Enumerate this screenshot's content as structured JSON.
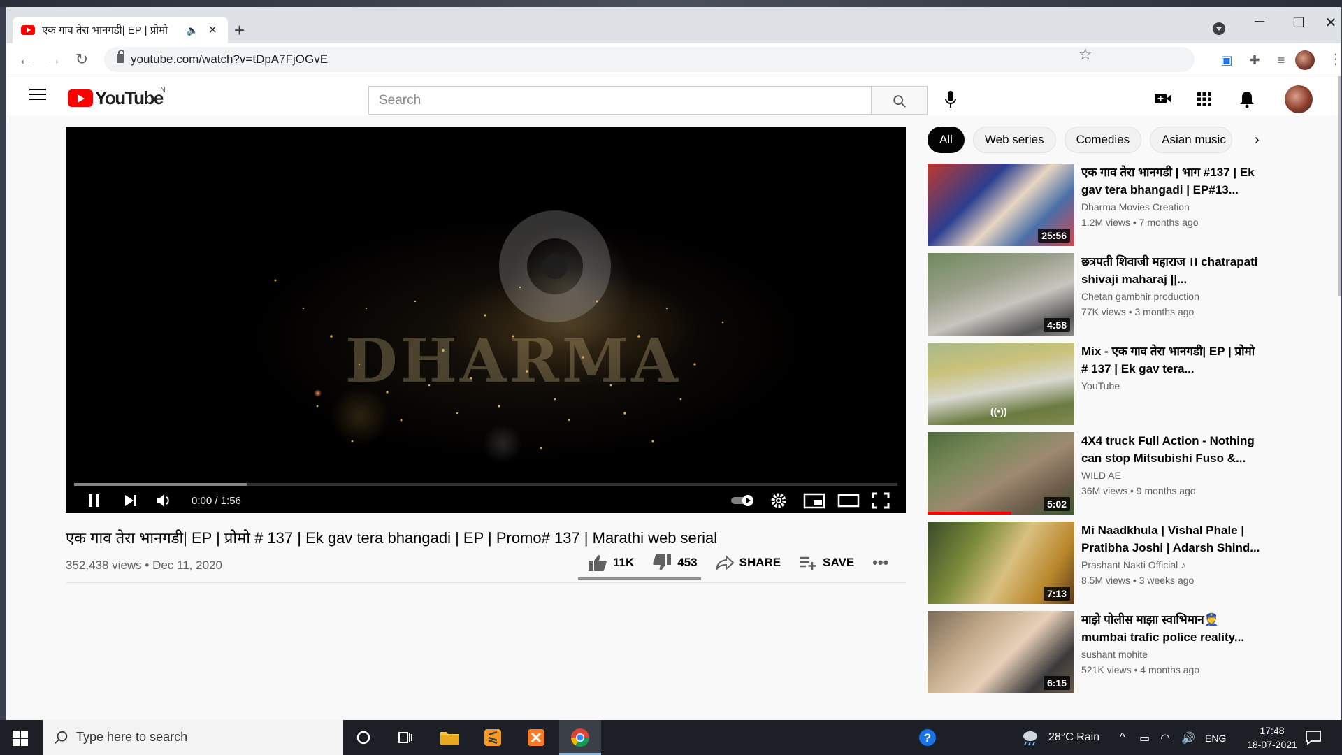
{
  "browser": {
    "tab_title": "एक गाव तेरा भानगडी| EP | प्रोमो",
    "url": "youtube.com/watch?v=tDpA7FjOGvE",
    "window_controls": {
      "minimize": "─",
      "maximize": "☐",
      "close": "✕"
    }
  },
  "youtube": {
    "logo_text": "YouTube",
    "country": "IN",
    "search_placeholder": "Search"
  },
  "player": {
    "time_display": "0:00 / 1:56",
    "wordmark": "DHARMA",
    "played_fraction": 0.0,
    "buffered_fraction": 0.21
  },
  "video": {
    "title": "एक गाव तेरा भानगडी| EP | प्रोमो # 137 | Ek gav tera bhangadi | EP | Promo# 137 | Marathi web serial",
    "views_date": "352,438 views • Dec 11, 2020",
    "likes": "11K",
    "dislikes": "453",
    "share_label": "SHARE",
    "save_label": "SAVE"
  },
  "chips": [
    "All",
    "Web series",
    "Comedies",
    "Asian music"
  ],
  "suggestions": [
    {
      "title": "एक गाव तेरा भानगडी | भाग #137 | Ek gav tera bhangadi | EP#13...",
      "channel": "Dharma Movies Creation",
      "meta": "1.2M views • 7 months ago",
      "duration": "25:56"
    },
    {
      "title": "छत्रपती शिवाजी महाराज ।। chatrapati shivaji maharaj ||...",
      "channel": "Chetan gambhir production",
      "meta": "77K views • 3 months ago",
      "duration": "4:58"
    },
    {
      "title": "Mix - एक गाव तेरा भानगडी| EP | प्रोमो # 137 | Ek gav tera...",
      "channel": "YouTube",
      "meta": "",
      "duration": ""
    },
    {
      "title": "4X4 truck Full Action - Nothing can stop Mitsubishi Fuso &...",
      "channel": "WILD AE",
      "meta": "36M views • 9 months ago",
      "duration": "5:02"
    },
    {
      "title": "Mi Naadkhula | Vishal Phale | Pratibha Joshi | Adarsh Shind...",
      "channel": "Prashant Nakti Official ♪",
      "meta": "8.5M views • 3 weeks ago",
      "duration": "7:13"
    },
    {
      "title": "माझे पोलीस माझा स्वाभिमान👮 mumbai trafic police reality...",
      "channel": "sushant mohite",
      "meta": "521K views • 4 months ago",
      "duration": "6:15"
    }
  ],
  "taskbar": {
    "search_placeholder": "Type here to search",
    "weather": "28°C  Rain",
    "language": "ENG",
    "time": "17:48",
    "date": "18-07-2021"
  }
}
